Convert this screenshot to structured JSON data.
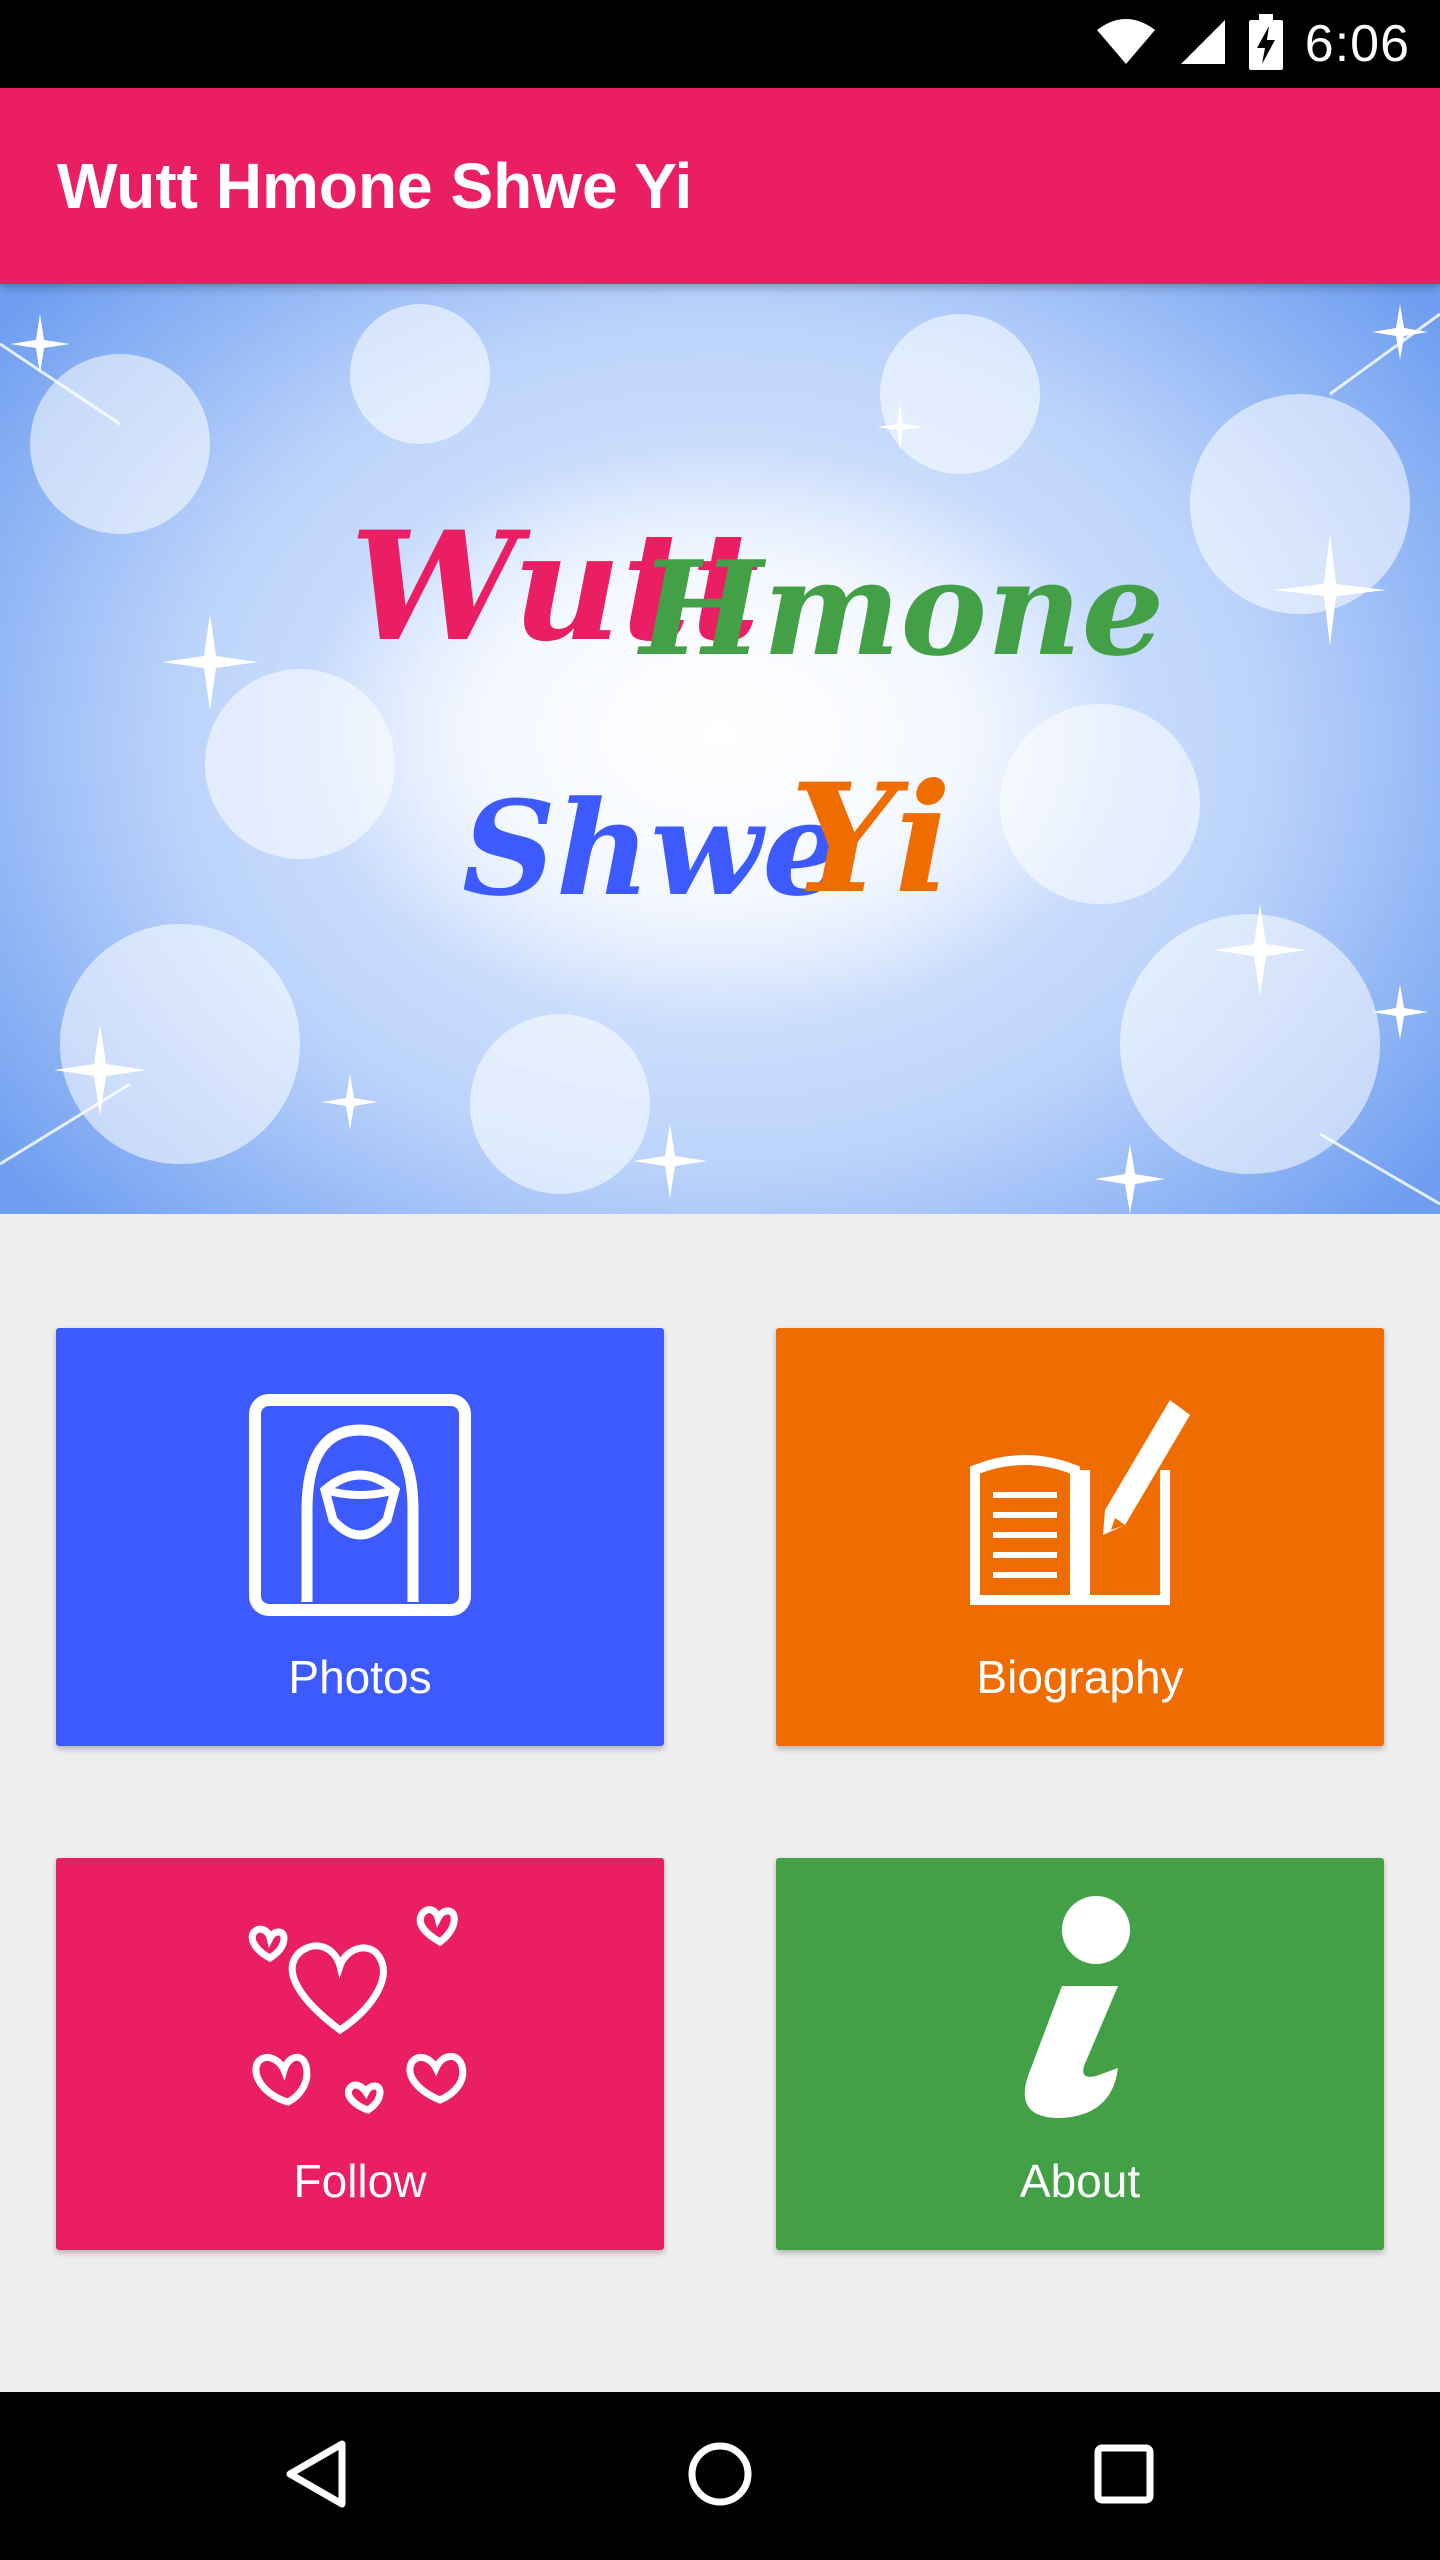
{
  "status_bar": {
    "time": "6:06",
    "icons": [
      "wifi-icon",
      "signal-icon",
      "battery-charging-icon"
    ]
  },
  "app_bar": {
    "title": "Wutt Hmone Shwe Yi",
    "color": "#e91e63"
  },
  "banner": {
    "logo_words": [
      {
        "text": "Wutt",
        "color": "#e91e63"
      },
      {
        "text": "Hmone",
        "color": "#43a047"
      },
      {
        "text": "Shwe",
        "color": "#3d5afe"
      },
      {
        "text": "Yi",
        "color": "#ef6c00"
      }
    ]
  },
  "tiles": [
    {
      "label": "Photos",
      "color": "#3d5afe",
      "icon": "portrait-frame-icon"
    },
    {
      "label": "Biography",
      "color": "#ef6c00",
      "icon": "book-pencil-icon"
    },
    {
      "label": "Follow",
      "color": "#e91e63",
      "icon": "hearts-icon"
    },
    {
      "label": "About",
      "color": "#43a047",
      "icon": "info-icon"
    }
  ],
  "nav_bar": {
    "buttons": [
      "back-icon",
      "home-icon",
      "recents-icon"
    ]
  }
}
